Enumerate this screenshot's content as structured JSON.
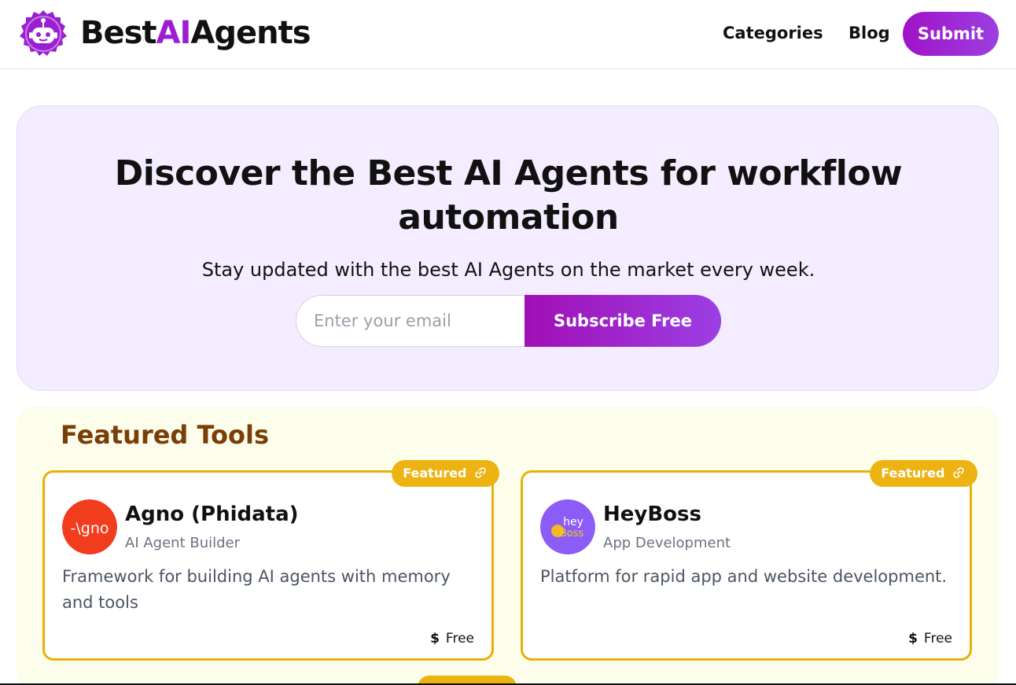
{
  "brand": {
    "name_part1": "Best",
    "name_part2": "AI",
    "name_part3": "Agents",
    "accent_color": "#9b1fd1",
    "logo_icon": "robot-badge-icon"
  },
  "nav": {
    "categories": "Categories",
    "blog": "Blog",
    "submit": "Submit"
  },
  "hero": {
    "title": "Discover the Best AI Agents for workflow automation",
    "subtitle": "Stay updated with the best AI Agents on the market every week.",
    "email_placeholder": "Enter your email",
    "email_value": "",
    "subscribe_label": "Subscribe Free"
  },
  "featured": {
    "title": "Featured Tools",
    "badge_color": "#ecb312",
    "cards": [
      {
        "badge": "Featured",
        "badge_icon": "link-icon",
        "logo_text": "-\\gno",
        "logo_color": "#f23c1e",
        "name": "Agno (Phidata)",
        "category": "AI Agent Builder",
        "description": "Framework for building AI agents with memory and tools",
        "price_icon": "$",
        "price": "Free"
      },
      {
        "badge": "Featured",
        "badge_icon": "link-icon",
        "logo_text_1": "hey",
        "logo_text_2": "Boss",
        "logo_color": "#8b5cf6",
        "name": "HeyBoss",
        "category": "App Development",
        "description": "Platform for rapid app and website development.",
        "price_icon": "$",
        "price": "Free"
      }
    ]
  }
}
